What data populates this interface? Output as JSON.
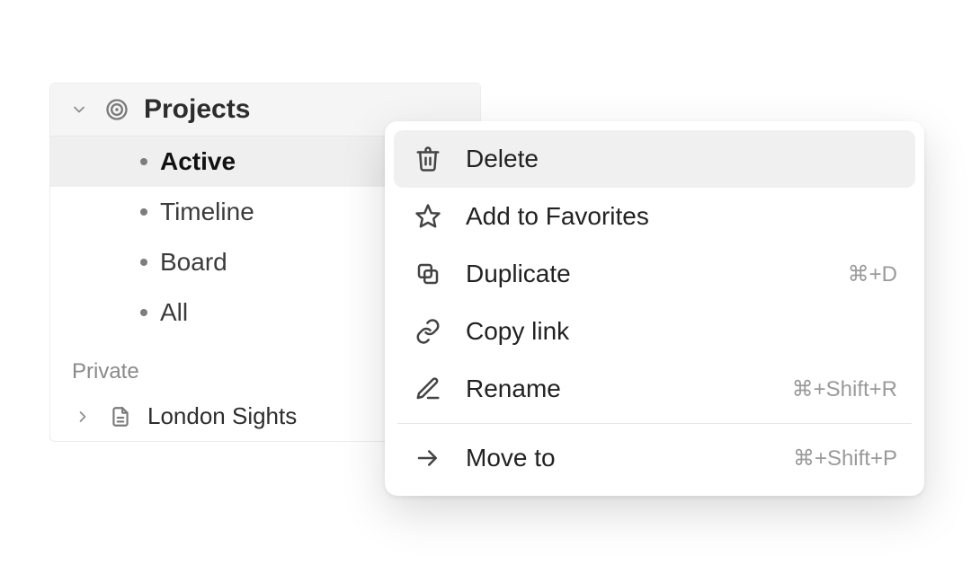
{
  "sidebar": {
    "header": {
      "label": "Projects"
    },
    "items": [
      {
        "label": "Active"
      },
      {
        "label": "Timeline"
      },
      {
        "label": "Board"
      },
      {
        "label": "All"
      }
    ],
    "private_section_label": "Private",
    "private_items": [
      {
        "label": "London Sights"
      }
    ]
  },
  "menu": {
    "items": [
      {
        "label": "Delete",
        "shortcut": ""
      },
      {
        "label": "Add to Favorites",
        "shortcut": ""
      },
      {
        "label": "Duplicate",
        "shortcut": "⌘+D"
      },
      {
        "label": "Copy link",
        "shortcut": ""
      },
      {
        "label": "Rename",
        "shortcut": "⌘+Shift+R"
      },
      {
        "label": "Move to",
        "shortcut": "⌘+Shift+P"
      }
    ]
  }
}
